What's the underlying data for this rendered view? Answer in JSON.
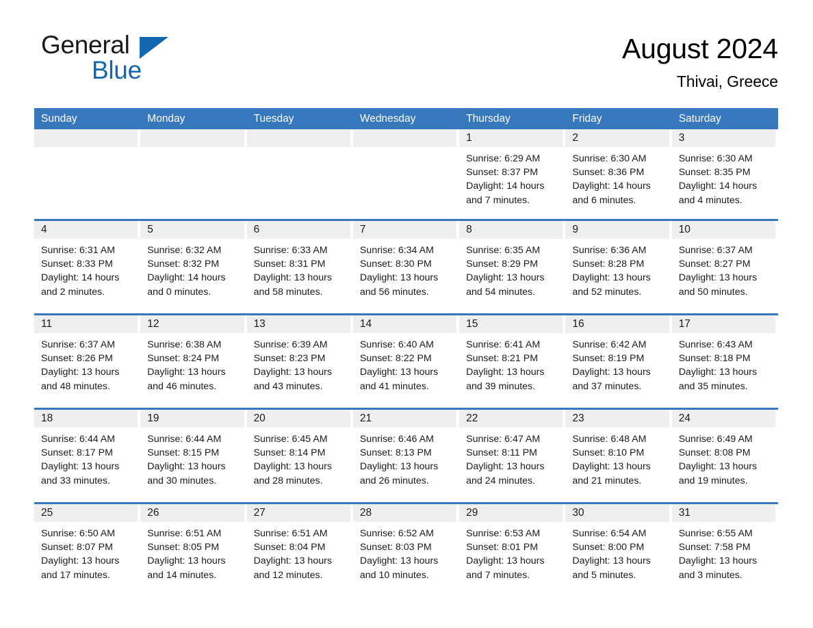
{
  "brand": {
    "name_part1": "General",
    "name_part2": "Blue",
    "triangle_icon": "triangle-icon",
    "accent_color": "#1267b0"
  },
  "header": {
    "title": "August 2024",
    "location": "Thivai, Greece"
  },
  "theme": {
    "header_blue": "#3778bc",
    "day_band_gray": "#efefef",
    "cell_white": "#ffffff"
  },
  "weekdays": [
    "Sunday",
    "Monday",
    "Tuesday",
    "Wednesday",
    "Thursday",
    "Friday",
    "Saturday"
  ],
  "weeks": [
    [
      {
        "day": "",
        "empty": true,
        "sunrise": "",
        "sunset": "",
        "daylight_l1": "",
        "daylight_l2": ""
      },
      {
        "day": "",
        "empty": true,
        "sunrise": "",
        "sunset": "",
        "daylight_l1": "",
        "daylight_l2": ""
      },
      {
        "day": "",
        "empty": true,
        "sunrise": "",
        "sunset": "",
        "daylight_l1": "",
        "daylight_l2": ""
      },
      {
        "day": "",
        "empty": true,
        "sunrise": "",
        "sunset": "",
        "daylight_l1": "",
        "daylight_l2": ""
      },
      {
        "day": "1",
        "sunrise": "Sunrise: 6:29 AM",
        "sunset": "Sunset: 8:37 PM",
        "daylight_l1": "Daylight: 14 hours",
        "daylight_l2": "and 7 minutes."
      },
      {
        "day": "2",
        "sunrise": "Sunrise: 6:30 AM",
        "sunset": "Sunset: 8:36 PM",
        "daylight_l1": "Daylight: 14 hours",
        "daylight_l2": "and 6 minutes."
      },
      {
        "day": "3",
        "sunrise": "Sunrise: 6:30 AM",
        "sunset": "Sunset: 8:35 PM",
        "daylight_l1": "Daylight: 14 hours",
        "daylight_l2": "and 4 minutes."
      }
    ],
    [
      {
        "day": "4",
        "sunrise": "Sunrise: 6:31 AM",
        "sunset": "Sunset: 8:33 PM",
        "daylight_l1": "Daylight: 14 hours",
        "daylight_l2": "and 2 minutes."
      },
      {
        "day": "5",
        "sunrise": "Sunrise: 6:32 AM",
        "sunset": "Sunset: 8:32 PM",
        "daylight_l1": "Daylight: 14 hours",
        "daylight_l2": "and 0 minutes."
      },
      {
        "day": "6",
        "sunrise": "Sunrise: 6:33 AM",
        "sunset": "Sunset: 8:31 PM",
        "daylight_l1": "Daylight: 13 hours",
        "daylight_l2": "and 58 minutes."
      },
      {
        "day": "7",
        "sunrise": "Sunrise: 6:34 AM",
        "sunset": "Sunset: 8:30 PM",
        "daylight_l1": "Daylight: 13 hours",
        "daylight_l2": "and 56 minutes."
      },
      {
        "day": "8",
        "sunrise": "Sunrise: 6:35 AM",
        "sunset": "Sunset: 8:29 PM",
        "daylight_l1": "Daylight: 13 hours",
        "daylight_l2": "and 54 minutes."
      },
      {
        "day": "9",
        "sunrise": "Sunrise: 6:36 AM",
        "sunset": "Sunset: 8:28 PM",
        "daylight_l1": "Daylight: 13 hours",
        "daylight_l2": "and 52 minutes."
      },
      {
        "day": "10",
        "sunrise": "Sunrise: 6:37 AM",
        "sunset": "Sunset: 8:27 PM",
        "daylight_l1": "Daylight: 13 hours",
        "daylight_l2": "and 50 minutes."
      }
    ],
    [
      {
        "day": "11",
        "sunrise": "Sunrise: 6:37 AM",
        "sunset": "Sunset: 8:26 PM",
        "daylight_l1": "Daylight: 13 hours",
        "daylight_l2": "and 48 minutes."
      },
      {
        "day": "12",
        "sunrise": "Sunrise: 6:38 AM",
        "sunset": "Sunset: 8:24 PM",
        "daylight_l1": "Daylight: 13 hours",
        "daylight_l2": "and 46 minutes."
      },
      {
        "day": "13",
        "sunrise": "Sunrise: 6:39 AM",
        "sunset": "Sunset: 8:23 PM",
        "daylight_l1": "Daylight: 13 hours",
        "daylight_l2": "and 43 minutes."
      },
      {
        "day": "14",
        "sunrise": "Sunrise: 6:40 AM",
        "sunset": "Sunset: 8:22 PM",
        "daylight_l1": "Daylight: 13 hours",
        "daylight_l2": "and 41 minutes."
      },
      {
        "day": "15",
        "sunrise": "Sunrise: 6:41 AM",
        "sunset": "Sunset: 8:21 PM",
        "daylight_l1": "Daylight: 13 hours",
        "daylight_l2": "and 39 minutes."
      },
      {
        "day": "16",
        "sunrise": "Sunrise: 6:42 AM",
        "sunset": "Sunset: 8:19 PM",
        "daylight_l1": "Daylight: 13 hours",
        "daylight_l2": "and 37 minutes."
      },
      {
        "day": "17",
        "sunrise": "Sunrise: 6:43 AM",
        "sunset": "Sunset: 8:18 PM",
        "daylight_l1": "Daylight: 13 hours",
        "daylight_l2": "and 35 minutes."
      }
    ],
    [
      {
        "day": "18",
        "sunrise": "Sunrise: 6:44 AM",
        "sunset": "Sunset: 8:17 PM",
        "daylight_l1": "Daylight: 13 hours",
        "daylight_l2": "and 33 minutes."
      },
      {
        "day": "19",
        "sunrise": "Sunrise: 6:44 AM",
        "sunset": "Sunset: 8:15 PM",
        "daylight_l1": "Daylight: 13 hours",
        "daylight_l2": "and 30 minutes."
      },
      {
        "day": "20",
        "sunrise": "Sunrise: 6:45 AM",
        "sunset": "Sunset: 8:14 PM",
        "daylight_l1": "Daylight: 13 hours",
        "daylight_l2": "and 28 minutes."
      },
      {
        "day": "21",
        "sunrise": "Sunrise: 6:46 AM",
        "sunset": "Sunset: 8:13 PM",
        "daylight_l1": "Daylight: 13 hours",
        "daylight_l2": "and 26 minutes."
      },
      {
        "day": "22",
        "sunrise": "Sunrise: 6:47 AM",
        "sunset": "Sunset: 8:11 PM",
        "daylight_l1": "Daylight: 13 hours",
        "daylight_l2": "and 24 minutes."
      },
      {
        "day": "23",
        "sunrise": "Sunrise: 6:48 AM",
        "sunset": "Sunset: 8:10 PM",
        "daylight_l1": "Daylight: 13 hours",
        "daylight_l2": "and 21 minutes."
      },
      {
        "day": "24",
        "sunrise": "Sunrise: 6:49 AM",
        "sunset": "Sunset: 8:08 PM",
        "daylight_l1": "Daylight: 13 hours",
        "daylight_l2": "and 19 minutes."
      }
    ],
    [
      {
        "day": "25",
        "sunrise": "Sunrise: 6:50 AM",
        "sunset": "Sunset: 8:07 PM",
        "daylight_l1": "Daylight: 13 hours",
        "daylight_l2": "and 17 minutes."
      },
      {
        "day": "26",
        "sunrise": "Sunrise: 6:51 AM",
        "sunset": "Sunset: 8:05 PM",
        "daylight_l1": "Daylight: 13 hours",
        "daylight_l2": "and 14 minutes."
      },
      {
        "day": "27",
        "sunrise": "Sunrise: 6:51 AM",
        "sunset": "Sunset: 8:04 PM",
        "daylight_l1": "Daylight: 13 hours",
        "daylight_l2": "and 12 minutes."
      },
      {
        "day": "28",
        "sunrise": "Sunrise: 6:52 AM",
        "sunset": "Sunset: 8:03 PM",
        "daylight_l1": "Daylight: 13 hours",
        "daylight_l2": "and 10 minutes."
      },
      {
        "day": "29",
        "sunrise": "Sunrise: 6:53 AM",
        "sunset": "Sunset: 8:01 PM",
        "daylight_l1": "Daylight: 13 hours",
        "daylight_l2": "and 7 minutes."
      },
      {
        "day": "30",
        "sunrise": "Sunrise: 6:54 AM",
        "sunset": "Sunset: 8:00 PM",
        "daylight_l1": "Daylight: 13 hours",
        "daylight_l2": "and 5 minutes."
      },
      {
        "day": "31",
        "sunrise": "Sunrise: 6:55 AM",
        "sunset": "Sunset: 7:58 PM",
        "daylight_l1": "Daylight: 13 hours",
        "daylight_l2": "and 3 minutes."
      }
    ]
  ]
}
